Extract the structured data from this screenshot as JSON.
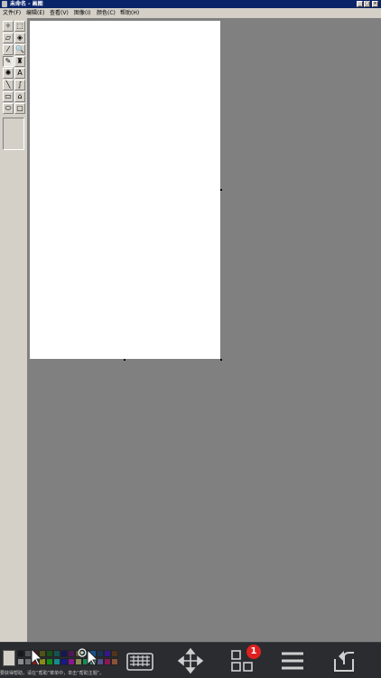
{
  "window": {
    "title": "未命名 - 画图",
    "minimize": "_",
    "maximize": "□",
    "close": "×"
  },
  "menu": [
    "文件(F)",
    "编辑(E)",
    "查看(V)",
    "图像(I)",
    "颜色(C)",
    "帮助(H)"
  ],
  "tools": [
    {
      "name": "free-select-tool",
      "glyph": "✧"
    },
    {
      "name": "rect-select-tool",
      "glyph": "⬚"
    },
    {
      "name": "eraser-tool",
      "glyph": "▱"
    },
    {
      "name": "fill-tool",
      "glyph": "◈"
    },
    {
      "name": "color-picker-tool",
      "glyph": "⁄"
    },
    {
      "name": "magnifier-tool",
      "glyph": "🔍"
    },
    {
      "name": "pencil-tool",
      "glyph": "✎"
    },
    {
      "name": "brush-tool",
      "glyph": "♜"
    },
    {
      "name": "airbrush-tool",
      "glyph": "✺"
    },
    {
      "name": "text-tool",
      "glyph": "A"
    },
    {
      "name": "line-tool",
      "glyph": "╲"
    },
    {
      "name": "curve-tool",
      "glyph": "∫"
    },
    {
      "name": "rectangle-tool",
      "glyph": "▭"
    },
    {
      "name": "polygon-tool",
      "glyph": "⌂"
    },
    {
      "name": "ellipse-tool",
      "glyph": "⬭"
    },
    {
      "name": "rounded-rect-tool",
      "glyph": "▢"
    }
  ],
  "active_tool": 6,
  "palette": [
    "#000000",
    "#808080",
    "#800000",
    "#808000",
    "#008000",
    "#008080",
    "#000080",
    "#800080",
    "#808040",
    "#004040",
    "#0080ff",
    "#004080",
    "#4000ff",
    "#804000",
    "#ffffff",
    "#c0c0c0",
    "#ff0000",
    "#ffff00",
    "#00ff00",
    "#00ffff",
    "#0000ff",
    "#ff00ff",
    "#ffff80",
    "#00ff80",
    "#80ffff",
    "#8080ff",
    "#ff0080",
    "#ff8040"
  ],
  "bottom_bar": {
    "buttons": [
      "keyboard-icon",
      "move-icon",
      "apps-icon",
      "menu-icon",
      "back-icon"
    ],
    "badge": "1"
  },
  "status": "要获得帮助，请在“帮助”菜单中，单击“帮助主题”。"
}
